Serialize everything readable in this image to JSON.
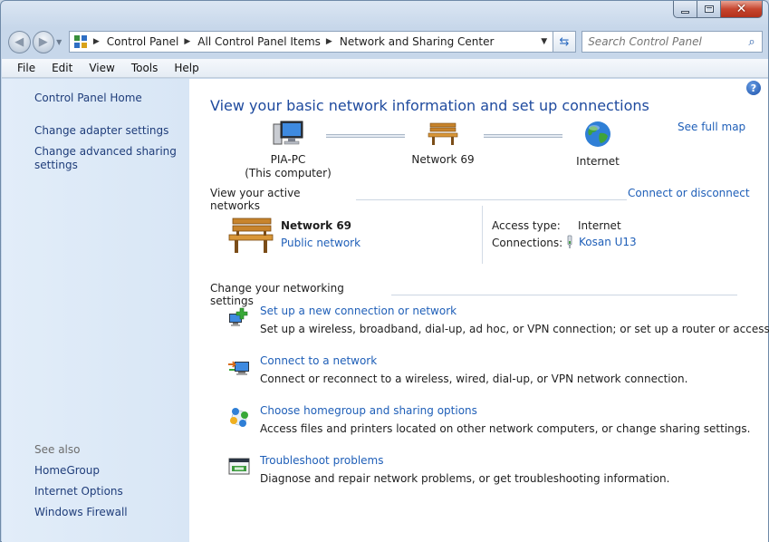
{
  "window": {
    "colors": {
      "link": "#1f5fb8",
      "title": "#1e4a9e",
      "sidebar_bg": "#dce9f7",
      "close_red": "#c7462f"
    }
  },
  "address_bar": {
    "breadcrumbs": [
      "Control Panel",
      "All Control Panel Items",
      "Network and Sharing Center"
    ],
    "icon": "control-panel-icon"
  },
  "search": {
    "placeholder": "Search Control Panel"
  },
  "menu": [
    "File",
    "Edit",
    "View",
    "Tools",
    "Help"
  ],
  "sidebar": {
    "home": "Control Panel Home",
    "adapter": "Change adapter settings",
    "sharing": "Change advanced sharing settings",
    "see_also": "See also",
    "links": [
      "HomeGroup",
      "Internet Options",
      "Windows Firewall"
    ]
  },
  "main": {
    "title": "View your basic network information and set up connections",
    "see_full_map": "See full map",
    "map": {
      "computer_name": "PIA-PC",
      "computer_sub": "(This computer)",
      "network_name": "Network  69",
      "internet": "Internet"
    },
    "active_header": "View your active networks",
    "connect_disconnect": "Connect or disconnect",
    "active_network": {
      "name": "Network  69",
      "type": "Public network",
      "access_type_label": "Access type:",
      "access_type_value": "Internet",
      "connections_label": "Connections:",
      "connections_value": "Kosan U13"
    },
    "change_header": "Change your networking settings",
    "tasks": [
      {
        "icon": "new-connection-icon",
        "link": "Set up a new connection or network",
        "desc": "Set up a wireless, broadband, dial-up, ad hoc, or VPN connection; or set up a router or access point."
      },
      {
        "icon": "connect-network-icon",
        "link": "Connect to a network",
        "desc": "Connect or reconnect to a wireless, wired, dial-up, or VPN network connection."
      },
      {
        "icon": "homegroup-icon",
        "link": "Choose homegroup and sharing options",
        "desc": "Access files and printers located on other network computers, or change sharing settings."
      },
      {
        "icon": "troubleshoot-icon",
        "link": "Troubleshoot problems",
        "desc": "Diagnose and repair network problems, or get troubleshooting information."
      }
    ]
  }
}
